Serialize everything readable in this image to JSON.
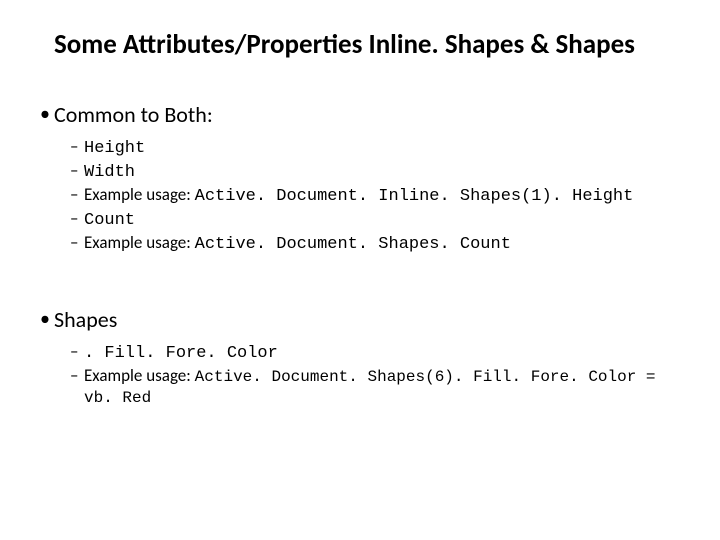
{
  "title": "Some Attributes/Properties Inline. Shapes & Shapes",
  "section1": {
    "heading": "Common to Both:",
    "items": [
      {
        "prefix": "",
        "text": "Height",
        "mono": true
      },
      {
        "prefix": "",
        "text": "Width",
        "mono": true
      },
      {
        "prefix": "Example usage:  ",
        "text": "Active. Document. Inline. Shapes(1). Height",
        "mono": true
      },
      {
        "prefix": "",
        "text": "Count",
        "mono": true
      },
      {
        "prefix": "Example usage: ",
        "text": "Active. Document. Shapes. Count",
        "mono": true
      }
    ]
  },
  "section2": {
    "heading": "Shapes",
    "items": [
      {
        "prefix": "",
        "text": ". Fill. Fore. Color",
        "mono": true
      },
      {
        "prefix": "Example usage: ",
        "text": "Active. Document. Shapes(6). Fill. Fore. Color = vb. Red",
        "mono": true,
        "small": true
      }
    ]
  }
}
